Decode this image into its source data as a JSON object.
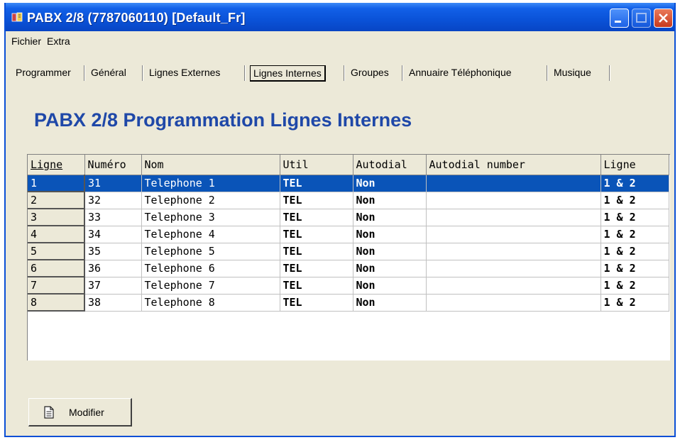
{
  "window": {
    "title": "PABX 2/8 (7787060110) [Default_Fr]",
    "icons": {
      "app": "app-icon",
      "minimize": "minimize-icon",
      "maximize": "maximize-icon",
      "close": "close-icon"
    }
  },
  "menu": {
    "items": [
      "Fichier",
      "Extra"
    ]
  },
  "tabs": [
    {
      "label": "Programmer"
    },
    {
      "label": "Général"
    },
    {
      "label": "Lignes Externes"
    },
    {
      "label": "Lignes Internes",
      "active": true
    },
    {
      "label": "Groupes"
    },
    {
      "label": "Annuaire Téléphonique"
    },
    {
      "label": "Musique"
    }
  ],
  "heading": "PABX 2/8 Programmation Lignes Internes",
  "table": {
    "columns": [
      "Ligne",
      "Numéro",
      "Nom",
      "Util",
      "Autodial",
      "Autodial number",
      "Ligne"
    ],
    "rows": [
      [
        "1",
        "31",
        "Telephone 1",
        "TEL",
        "Non",
        "",
        "1 & 2"
      ],
      [
        "2",
        "32",
        "Telephone 2",
        "TEL",
        "Non",
        "",
        "1 & 2"
      ],
      [
        "3",
        "33",
        "Telephone 3",
        "TEL",
        "Non",
        "",
        "1 & 2"
      ],
      [
        "4",
        "34",
        "Telephone 4",
        "TEL",
        "Non",
        "",
        "1 & 2"
      ],
      [
        "5",
        "35",
        "Telephone 5",
        "TEL",
        "Non",
        "",
        "1 & 2"
      ],
      [
        "6",
        "36",
        "Telephone 6",
        "TEL",
        "Non",
        "",
        "1 & 2"
      ],
      [
        "7",
        "37",
        "Telephone 7",
        "TEL",
        "Non",
        "",
        "1 & 2"
      ],
      [
        "8",
        "38",
        "Telephone 8",
        "TEL",
        "Non",
        "",
        "1 & 2"
      ]
    ],
    "selected_row": 0
  },
  "buttons": {
    "modify_label": "Modifier",
    "modify_icon": "document-icon"
  },
  "colors": {
    "titlebar": "#0a52d8",
    "heading": "#1f48a8",
    "selection": "#0a54b8",
    "face": "#ece9d8"
  }
}
